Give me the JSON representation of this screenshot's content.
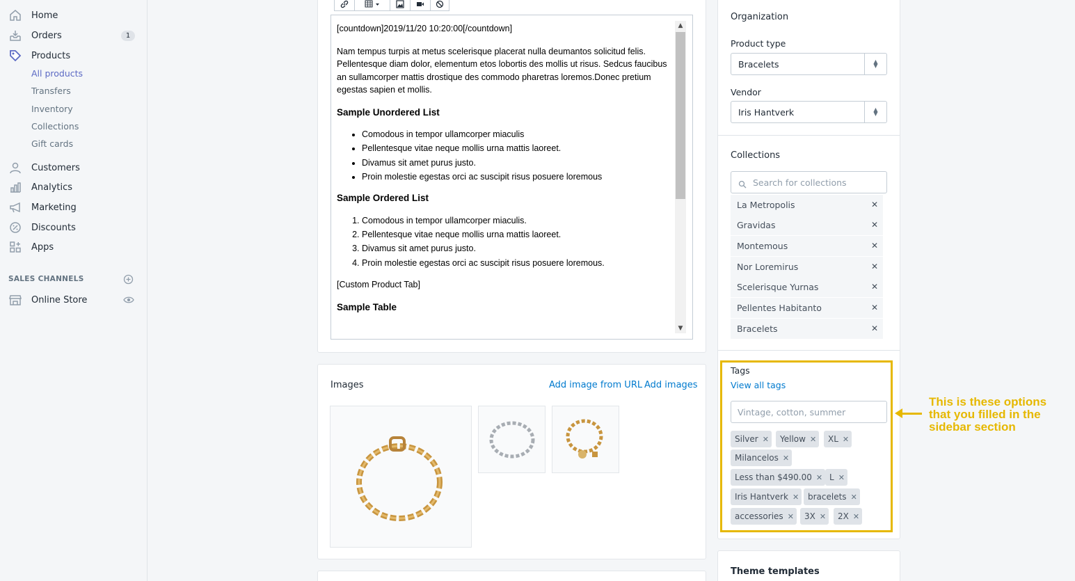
{
  "sidebar": {
    "nav": [
      {
        "label": "Home",
        "icon": "home-icon"
      },
      {
        "label": "Orders",
        "icon": "orders-icon",
        "badge": "1"
      },
      {
        "label": "Products",
        "icon": "tag-icon"
      }
    ],
    "product_sub": [
      "All products",
      "Transfers",
      "Inventory",
      "Collections",
      "Gift cards"
    ],
    "nav2": [
      {
        "label": "Customers",
        "icon": "person-icon"
      },
      {
        "label": "Analytics",
        "icon": "analytics-icon"
      },
      {
        "label": "Marketing",
        "icon": "megaphone-icon"
      },
      {
        "label": "Discounts",
        "icon": "discount-icon"
      },
      {
        "label": "Apps",
        "icon": "apps-icon"
      }
    ],
    "sales_channels_title": "SALES CHANNELS",
    "online_store": "Online Store"
  },
  "editor": {
    "countdown": "[countdown]2019/11/20 10:20:00[/countdown]",
    "paragraph": "Nam tempus turpis at metus scelerisque placerat nulla deumantos solicitud felis. Pellentesque diam dolor, elementum etos lobortis des mollis ut risus. Sedcus faucibus an sullamcorper mattis drostique des commodo pharetras loremos.Donec pretium egestas sapien et mollis.",
    "ul_title": "Sample Unordered List",
    "ul_items": [
      "Comodous in tempor ullamcorper miaculis",
      "Pellentesque vitae neque mollis urna mattis laoreet.",
      "Divamus sit amet purus justo.",
      "Proin molestie egestas orci ac suscipit risus posuere loremous"
    ],
    "ol_title": "Sample Ordered List",
    "ol_items": [
      "Comodous in tempor ullamcorper miaculis.",
      "Pellentesque vitae neque mollis urna mattis laoreet.",
      "Divamus sit amet purus justo.",
      "Proin molestie egestas orci ac suscipit risus posuere loremous."
    ],
    "custom_tab": "[Custom Product Tab]",
    "table_title": "Sample Table"
  },
  "images": {
    "title": "Images",
    "add_url": "Add image from URL",
    "add_images": "Add images"
  },
  "organization": {
    "title": "Organization",
    "product_type_label": "Product type",
    "product_type": "Bracelets",
    "vendor_label": "Vendor",
    "vendor": "Iris Hantverk"
  },
  "collections": {
    "title": "Collections",
    "placeholder": "Search for collections",
    "items": [
      "La Metropolis",
      "Gravidas",
      "Montemous",
      "Nor Loremirus",
      "Scelerisque Yurnas",
      "Pellentes Habitanto",
      "Bracelets"
    ]
  },
  "tags": {
    "title": "Tags",
    "view_all": "View all tags",
    "placeholder": "Vintage, cotton, summer",
    "items": [
      "Silver",
      "Yellow",
      "XL",
      "Milancelos",
      "Less than $490.00",
      "L",
      "Iris Hantverk",
      "bracelets",
      "accessories",
      "3X",
      "2X"
    ]
  },
  "annotation": "This is these options that you filled in the sidebar section",
  "theme_templates": "Theme templates",
  "colors": {
    "accent": "#5c6ac4",
    "link": "#007ace",
    "highlight": "#e6b800"
  }
}
